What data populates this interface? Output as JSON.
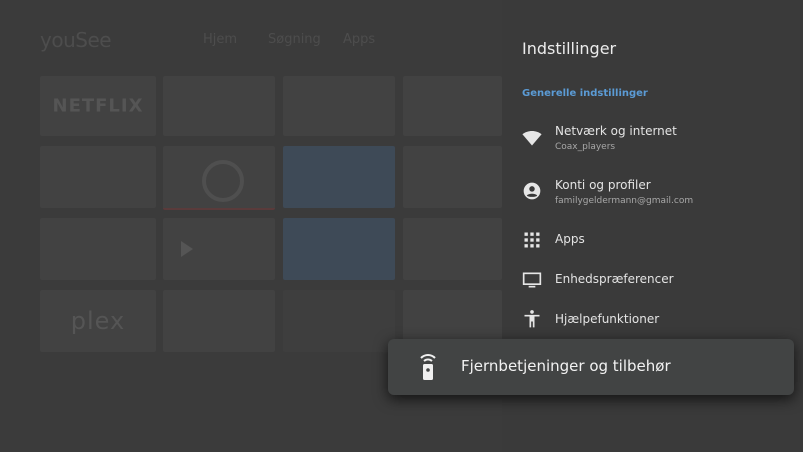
{
  "home": {
    "logo": "youSee",
    "nav": [
      "Hjem",
      "Søgning",
      "Apps"
    ],
    "tiles": [
      "NETFLIX",
      "plex"
    ]
  },
  "settings": {
    "title": "Indstillinger",
    "section": "Generelle indstillinger",
    "items": [
      {
        "label": "Netværk og internet",
        "sub": "Coax_players",
        "icon": "wifi-icon"
      },
      {
        "label": "Konti og profiler",
        "sub": "familygeldermann@gmail.com",
        "icon": "account-icon"
      },
      {
        "label": "Apps",
        "icon": "apps-grid-icon"
      },
      {
        "label": "Enhedspræferencer",
        "icon": "tv-icon"
      },
      {
        "label": "Hjælpefunktioner",
        "icon": "accessibility-icon"
      }
    ],
    "focused": {
      "label": "Fjernbetjeninger og tilbehør",
      "icon": "remote-icon"
    }
  }
}
